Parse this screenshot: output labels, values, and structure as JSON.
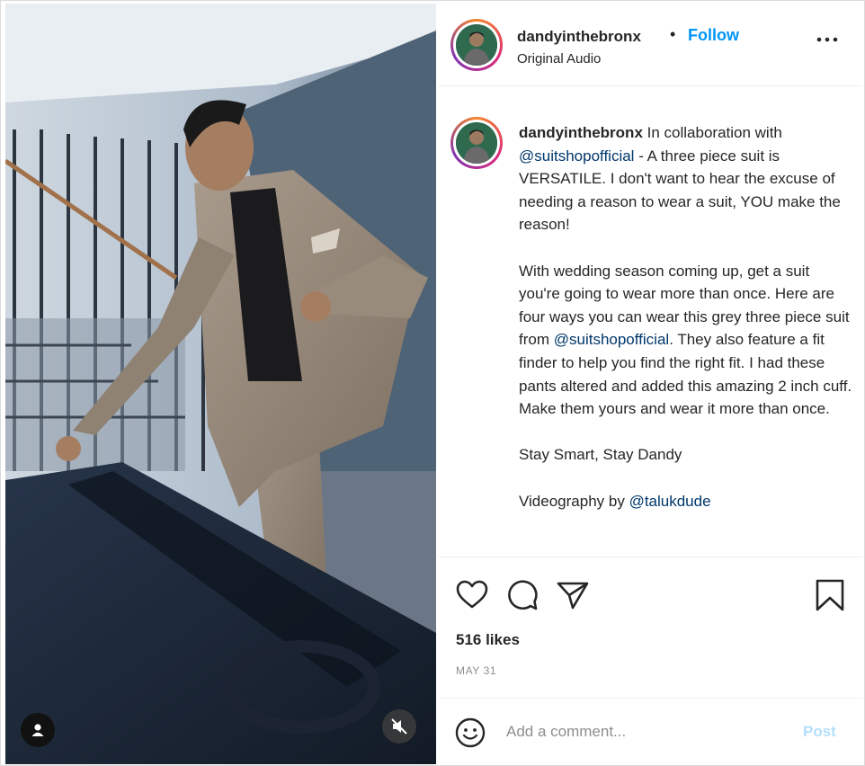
{
  "post": {
    "username": "dandyinthebronx",
    "dot": "•",
    "follow_label": "Follow",
    "audio": "Original Audio"
  },
  "caption": {
    "username": "dandyinthebronx",
    "p1_pre": " In collaboration with ",
    "mention1": "@suitshopofficial",
    "p1_post": " - A three piece suit is VERSATILE. I don't want to hear the excuse of needing a reason to wear a suit, YOU make the reason!",
    "p2_pre": "With wedding season coming up, get a suit you're going to wear more than once. Here are four ways you can wear this grey three piece suit from ",
    "mention2": "@suitshopofficial",
    "p2_post": ". They also feature a fit finder to help you find the right fit. I had these pants altered and added this amazing 2 inch cuff. Make them yours and wear it more than once.",
    "p3": "Stay Smart, Stay Dandy",
    "p4_pre": "Videography by ",
    "mention3": "@talukdude"
  },
  "stats": {
    "likes": "516 likes",
    "date": "MAY 31"
  },
  "comment": {
    "placeholder": "Add a comment...",
    "post_label": "Post"
  },
  "icons": {
    "like": "heart-icon",
    "comment": "comment-icon",
    "share": "paper-plane-icon",
    "save": "bookmark-icon",
    "more": "more-dots-icon",
    "emoji": "emoji-icon",
    "user_tag": "user-icon",
    "mute": "speaker-muted-icon"
  },
  "colors": {
    "follow": "#0095f6",
    "mention": "#00376b",
    "post_disabled": "#b2dffc"
  }
}
